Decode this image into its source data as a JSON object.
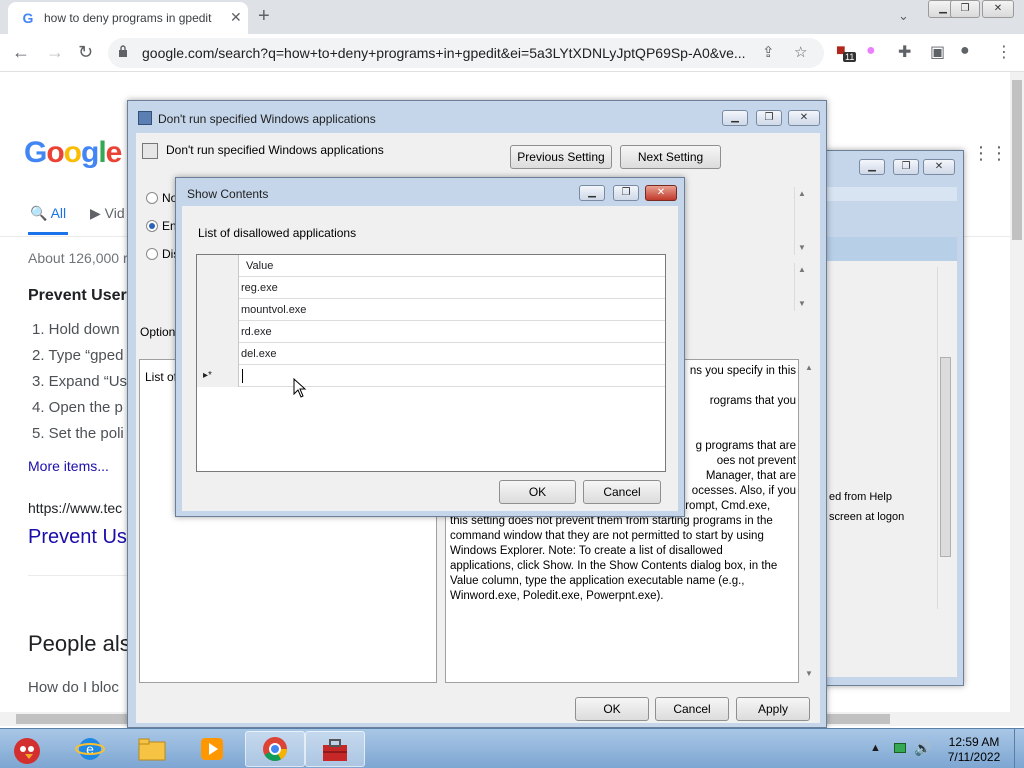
{
  "browser": {
    "tab_title": "how to deny programs in gpedit",
    "tab_favicon": "G",
    "url": "google.com/search?q=how+to+deny+programs+in+gpedit&ei=5a3LYtXDNLyJptQP69Sp-A0&ve...",
    "ext_badge": "11",
    "icons": {
      "back": "back-arrow-icon",
      "forward": "forward-arrow-icon",
      "reload": "reload-icon",
      "lock": "lock-icon",
      "share": "share-icon",
      "bookmark": "star-icon",
      "extensions": "puzzle-icon",
      "sidepanel": "side-panel-icon",
      "profile": "profile-icon",
      "menu": "kebab-menu-icon"
    }
  },
  "google": {
    "logo": [
      "G",
      "o",
      "o",
      "g",
      "l",
      "e"
    ],
    "tab_all": "All",
    "tab_videos": "Vid",
    "result_count": "About 126,000 r",
    "snippet_title": "Prevent Users",
    "steps": [
      "1. Hold down",
      "2. Type “gped",
      "3. Expand “Us",
      "4. Open the p",
      "5. Set the poli"
    ],
    "more_items": "More items...",
    "cite": "https://www.tec",
    "result_title": "Prevent Use",
    "people_also": "People als",
    "question": "How do I bloc"
  },
  "policy_dialog": {
    "title": "Don't run specified Windows applications",
    "header": "Don't run specified Windows applications",
    "prev_button": "Previous Setting",
    "next_button": "Next Setting",
    "radio_not": "No",
    "radio_enabled": "En",
    "radio_disabled": "Dis",
    "options_label": "Option",
    "list_label": "List of",
    "help_lines": [
      "ns you specify in this",
      "",
      "rograms that you",
      "",
      "",
      "g programs that are",
      "oes not prevent",
      "Manager, that are",
      "ocesses. Also, if you",
      "permit users to gain access to the command prompt, Cmd.exe,",
      "this setting does not prevent them from starting programs in the",
      "command window that they are not permitted to start by using",
      "Windows Explorer. Note: To create a list of disallowed",
      "applications, click Show. In the Show Contents dialog box, in the",
      "Value column, type the application executable name (e.g.,",
      "Winword.exe, Poledit.exe, Powerpnt.exe)."
    ],
    "ok_button": "OK",
    "cancel_button": "Cancel",
    "apply_button": "Apply"
  },
  "back_window": {
    "text1": "ed from Help",
    "text2": "screen at logon"
  },
  "show_contents": {
    "title": "Show Contents",
    "label": "List of disallowed applications",
    "column_header": "Value",
    "rows": [
      "reg.exe",
      "mountvol.exe",
      "rd.exe",
      "del.exe"
    ],
    "new_row_marker": "▸*",
    "ok_button": "OK",
    "cancel_button": "Cancel"
  },
  "taskbar": {
    "time": "12:59 AM",
    "date": "7/11/2022",
    "apps": [
      "angry-birds-icon",
      "ie-icon",
      "folder-icon",
      "media-player-icon",
      "chrome-icon",
      "toolbox-icon"
    ]
  },
  "colors": {
    "google_blue": "#4285f4",
    "link_blue": "#1a0dab",
    "win7_frame": "#c5d6ea",
    "close_red": "#c0392b"
  }
}
